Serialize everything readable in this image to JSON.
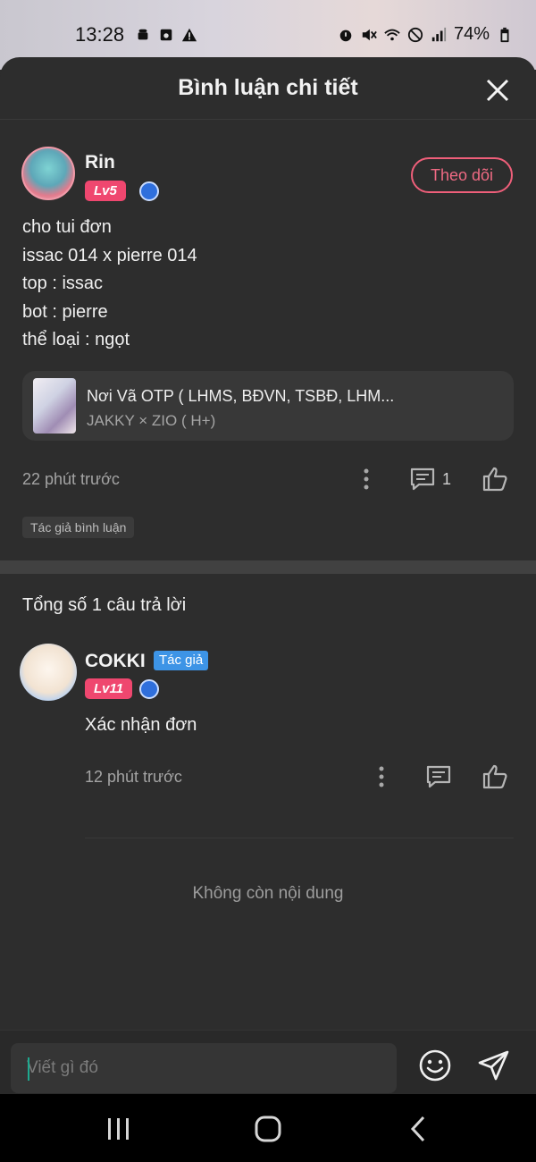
{
  "status_bar": {
    "time": "13:28",
    "battery": "74%",
    "left_icons": [
      "android-icon",
      "camera-icon",
      "warning-icon"
    ],
    "right_icons": [
      "alarm-icon",
      "mute-icon",
      "wifi-icon",
      "dnd-icon",
      "signal-icon",
      "battery-icon"
    ]
  },
  "sheet": {
    "title": "Bình luận chi tiết",
    "close_icon": "close-icon"
  },
  "comment": {
    "username": "Rin",
    "level": "Lv5",
    "follow_label": "Theo dõi",
    "lines": [
      "cho tui đơn",
      "issac 014 x pierre 014",
      "top : issac",
      "bot : pierre",
      "thể loại : ngọt"
    ],
    "story": {
      "title": "Nơi Vã OTP ( LHMS, BĐVN, TSBĐ, LHM...",
      "subtitle": "JAKKY × ZIO ( H+)"
    },
    "time": "22 phút trước",
    "reply_count": "1",
    "tag": "Tác giả bình luận"
  },
  "replies": {
    "title": "Tổng số 1 câu trả lời",
    "items": [
      {
        "username": "COKKI",
        "author_tag": "Tác giả",
        "level": "Lv11",
        "text": "Xác nhận đơn",
        "time": "12 phút trước"
      }
    ],
    "end_text": "Không còn nội dung"
  },
  "composer": {
    "placeholder": "Viết gì đó",
    "emoji_icon": "emoji-icon",
    "send_icon": "send-icon"
  },
  "colors": {
    "background": "#2d2d2d",
    "accent_pink": "#ef476f",
    "author_blue": "#3d94e6"
  }
}
